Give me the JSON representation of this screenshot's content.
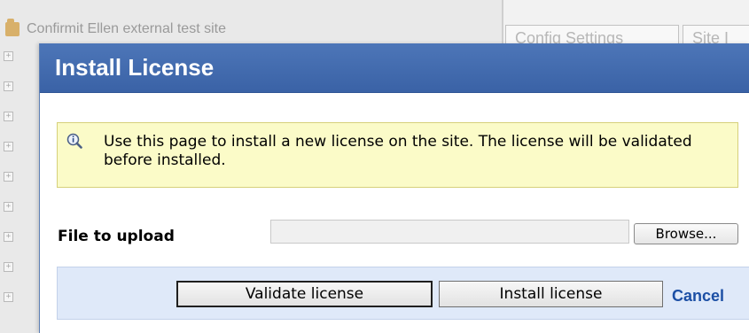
{
  "background": {
    "tree_root_label": "Confirmit Ellen external test site",
    "expander_glyph": "+",
    "tabs": [
      "Config Settings",
      "Site I"
    ]
  },
  "dialog": {
    "title": "Install License",
    "info_text": "Use this page to install a new license on the site. The license will be validated before installed.",
    "file_label": "File to upload",
    "file_value": "",
    "browse_label": "Browse...",
    "validate_label": "Validate license",
    "install_label": "Install license",
    "cancel_label": "Cancel"
  },
  "colors": {
    "header": "#3f67aa",
    "info_bg": "#fbfbc8",
    "action_bar_bg": "#dfe9f9",
    "cancel_link": "#1c4fa5"
  },
  "icons": {
    "info": "magnifier-info-icon",
    "folder": "folder-icon"
  }
}
